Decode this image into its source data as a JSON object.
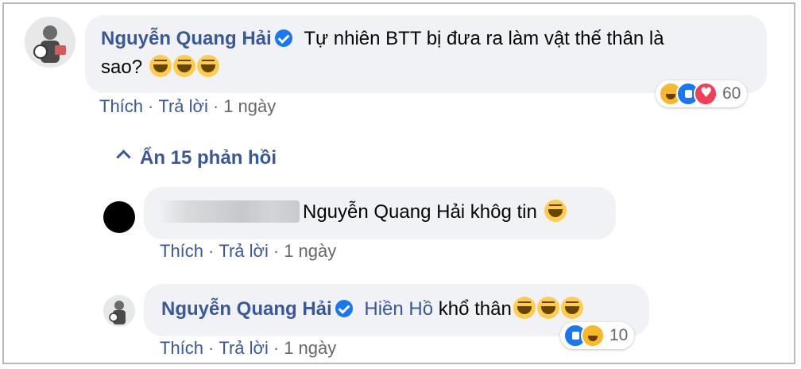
{
  "comment": {
    "author": "Nguyễn Quang Hải",
    "text_line1": "Tự nhiên BTT bị đưa ra làm vật thế thân là",
    "text_line2": "sao?",
    "like_label": "Thích",
    "reply_label": "Trả lời",
    "time": "1 ngày",
    "reaction_count": "60",
    "reactions": [
      "haha",
      "like",
      "love"
    ]
  },
  "replies_toggle": {
    "label": "Ẩn 15 phản hồi"
  },
  "reply1": {
    "text": "Nguyễn Quang Hải khôg tin",
    "like_label": "Thích",
    "reply_label": "Trả lời",
    "time": "1 ngày"
  },
  "reply2": {
    "author": "Nguyễn Quang Hải",
    "mention": "Hiền Hồ",
    "text": "khổ thân",
    "like_label": "Thích",
    "reply_label": "Trả lời",
    "time": "1 ngày",
    "reaction_count": "10",
    "reactions": [
      "like",
      "haha"
    ]
  },
  "separator": "·",
  "colors": {
    "author": "#385898",
    "bubble": "#f0f2f5",
    "meta": "#65676b",
    "verified": "#1877f2"
  }
}
